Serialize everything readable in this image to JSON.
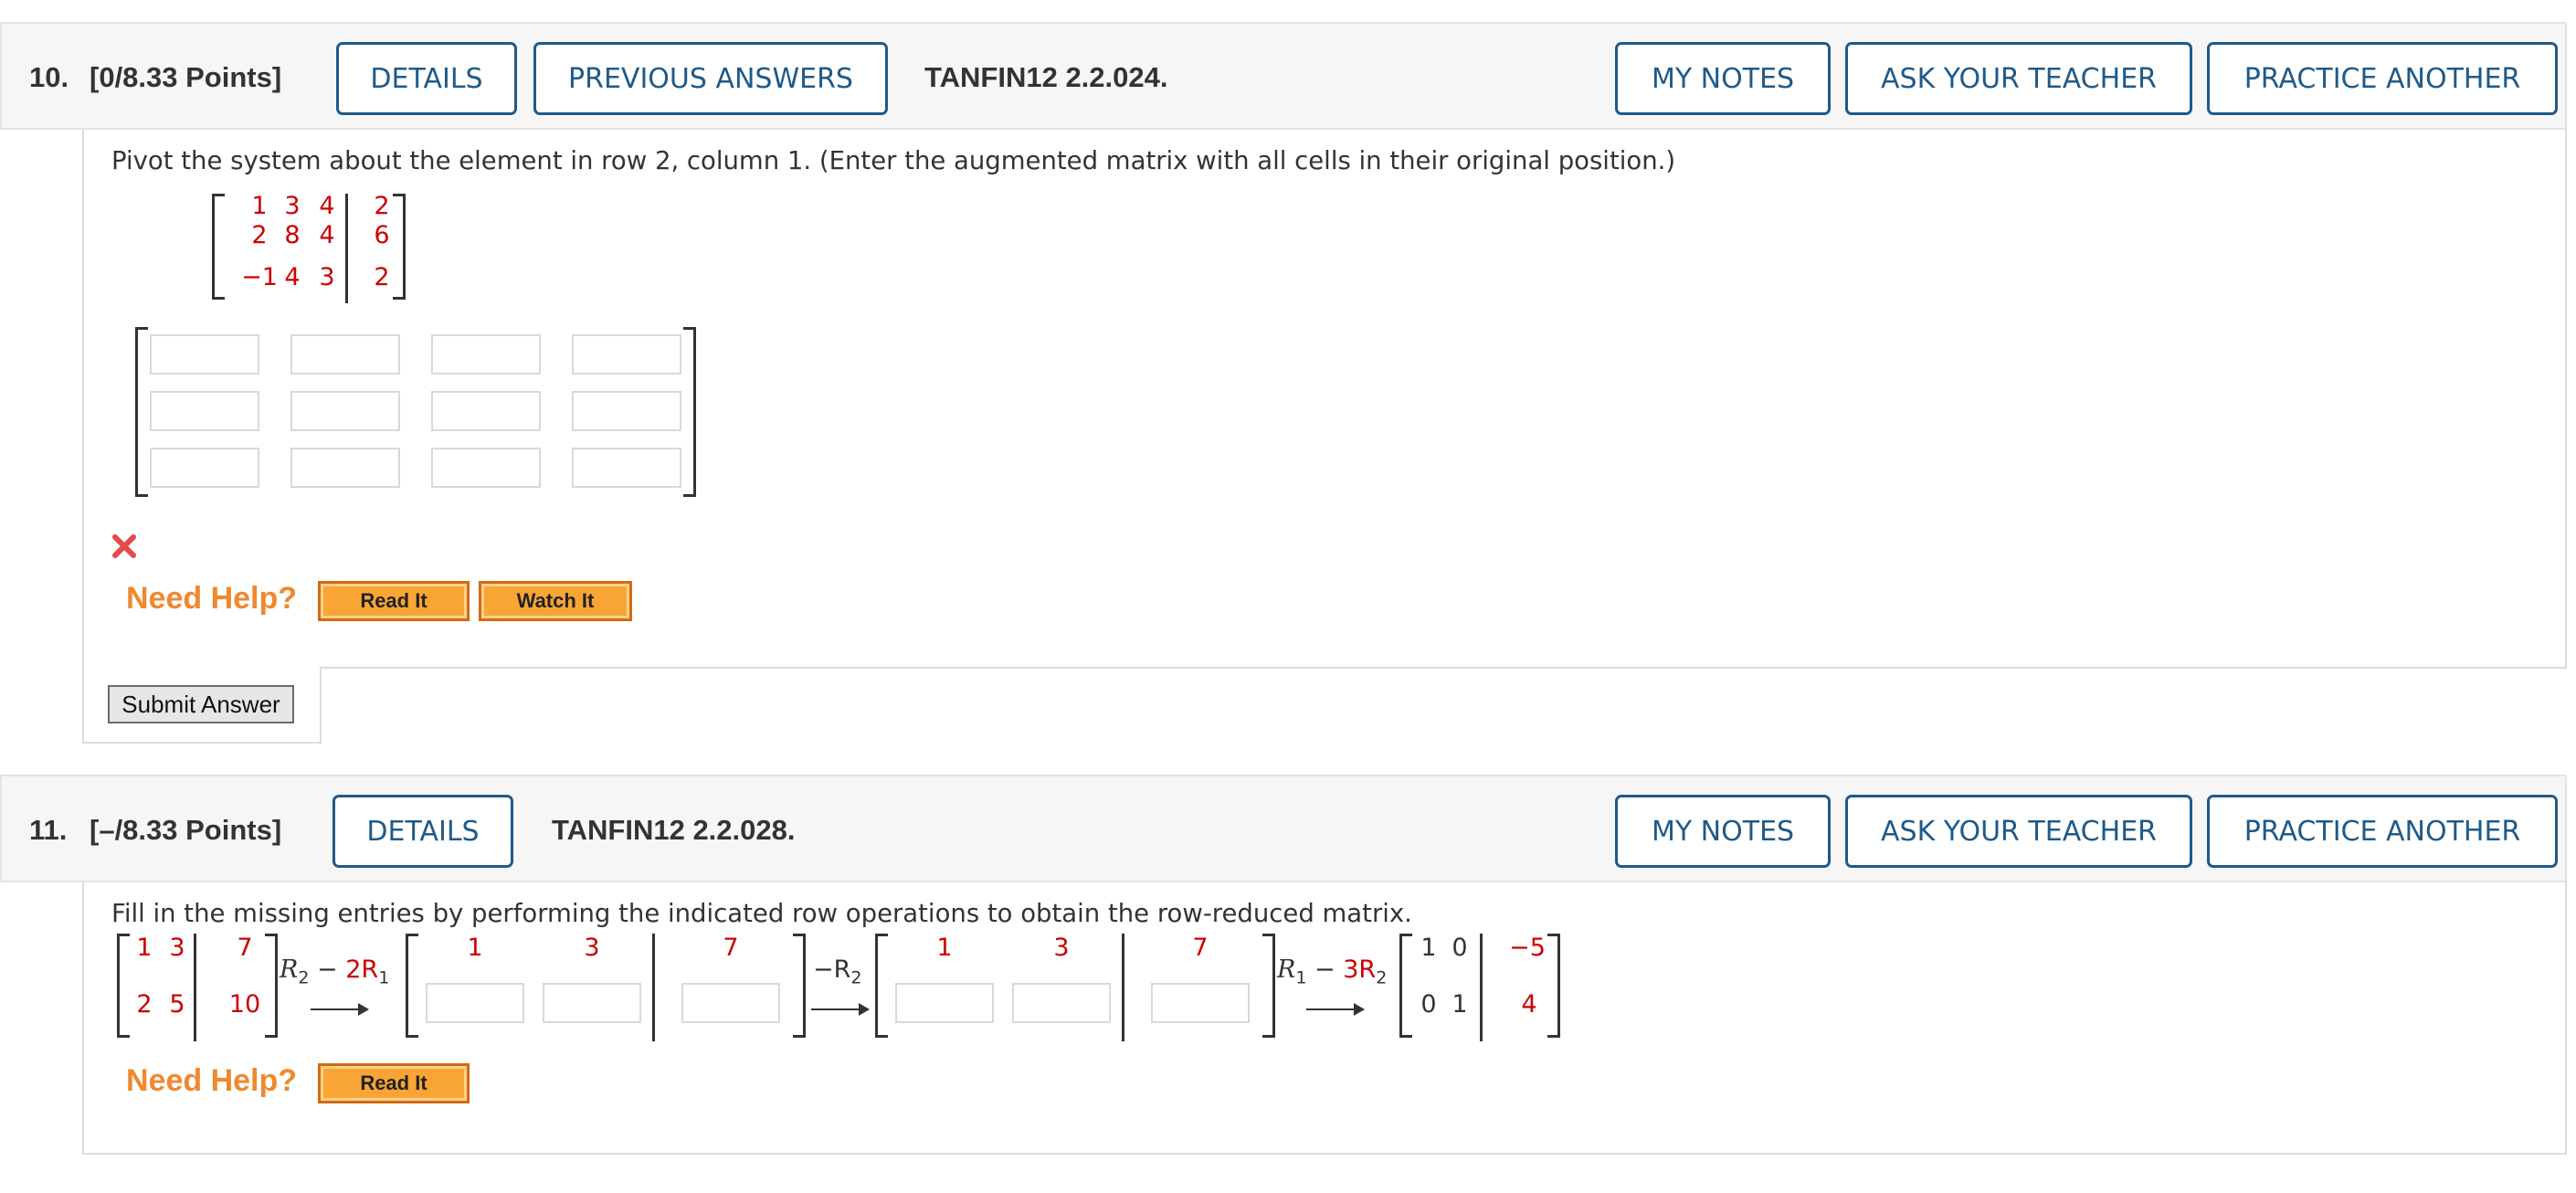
{
  "q10": {
    "number": "10.",
    "points": "[0/8.33 Points]",
    "details": "DETAILS",
    "previous_answers": "PREVIOUS ANSWERS",
    "code": "TANFIN12 2.2.024.",
    "my_notes": "MY NOTES",
    "ask_teacher": "ASK YOUR TEACHER",
    "practice": "PRACTICE ANOTHER",
    "prompt": "Pivot the system about the element in row 2, column 1. (Enter the augmented matrix with all cells in their original position.)",
    "matrix": {
      "r1": [
        "1",
        "3",
        "4",
        "2"
      ],
      "r2": [
        "2",
        "8",
        "4",
        "6"
      ],
      "r3": [
        "−1",
        "4",
        "3",
        "2"
      ]
    },
    "incorrect_icon": "close-icon",
    "need_help": "Need Help?",
    "read_it": "Read It",
    "watch_it": "Watch It",
    "submit": "Submit Answer"
  },
  "q11": {
    "number": "11.",
    "points": "[–/8.33 Points]",
    "details": "DETAILS",
    "code": "TANFIN12 2.2.028.",
    "my_notes": "MY NOTES",
    "ask_teacher": "ASK YOUR TEACHER",
    "practice": "PRACTICE ANOTHER",
    "prompt": "Fill in the missing entries by performing the indicated row operations to obtain the row-reduced matrix.",
    "m1": {
      "r1": [
        "1",
        "3",
        "7"
      ],
      "r2": [
        "2",
        "5",
        "10"
      ]
    },
    "op1": {
      "left": "R",
      "left_sub": "2",
      "minus": " − ",
      "coef": "2R",
      "coef_sub": "1"
    },
    "m2": {
      "r1": [
        "1",
        "3",
        "7"
      ]
    },
    "op2": {
      "text": "−R",
      "sub": "2"
    },
    "m3": {
      "r1": [
        "1",
        "3",
        "7"
      ]
    },
    "op3": {
      "left": "R",
      "left_sub": "1",
      "minus": " − ",
      "coef": "3R",
      "coef_sub": "2"
    },
    "m4": {
      "r1": [
        "1",
        "0",
        "−5"
      ],
      "r2": [
        "0",
        "1",
        "4"
      ]
    },
    "need_help": "Need Help?",
    "read_it": "Read It"
  },
  "colors": {
    "accent_blue": "#1e5a8a",
    "red_values": "#cc0000",
    "help_orange": "#f0882f",
    "button_orange": "#f8a535"
  }
}
